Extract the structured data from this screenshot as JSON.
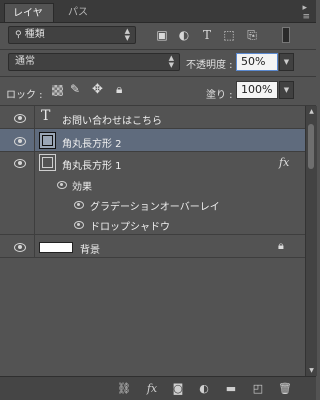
{
  "tabs": [
    {
      "label": "レイヤー",
      "active": true
    },
    {
      "label": "パス",
      "active": false
    }
  ],
  "panel_menu_icon": "panel-menu-icon",
  "filter": {
    "label": "種類",
    "icon": "search-icon"
  },
  "blend_mode": {
    "value": "通常"
  },
  "opacity": {
    "label": "不透明度 :",
    "value": "50%"
  },
  "lock": {
    "label": "ロック :"
  },
  "fill": {
    "label": "塗り :",
    "value": "100%"
  },
  "layers": [
    {
      "name": "お問い合わせはこちら",
      "type": "text",
      "selected": false
    },
    {
      "name": "角丸長方形 2",
      "type": "shape",
      "selected": true
    },
    {
      "name": "角丸長方形 1",
      "type": "shape",
      "selected": false,
      "fx": "fx"
    },
    {
      "name": "効果",
      "type": "effects-group"
    },
    {
      "name": "グラデーションオーバーレイ",
      "type": "effect"
    },
    {
      "name": "ドロップシャドウ",
      "type": "effect"
    },
    {
      "name": "背景",
      "type": "background",
      "locked": true
    }
  ],
  "colors": {
    "panel_bg": "#535353",
    "selected_bg": "#5f6b7d",
    "input_border": "#5b8ad1"
  }
}
